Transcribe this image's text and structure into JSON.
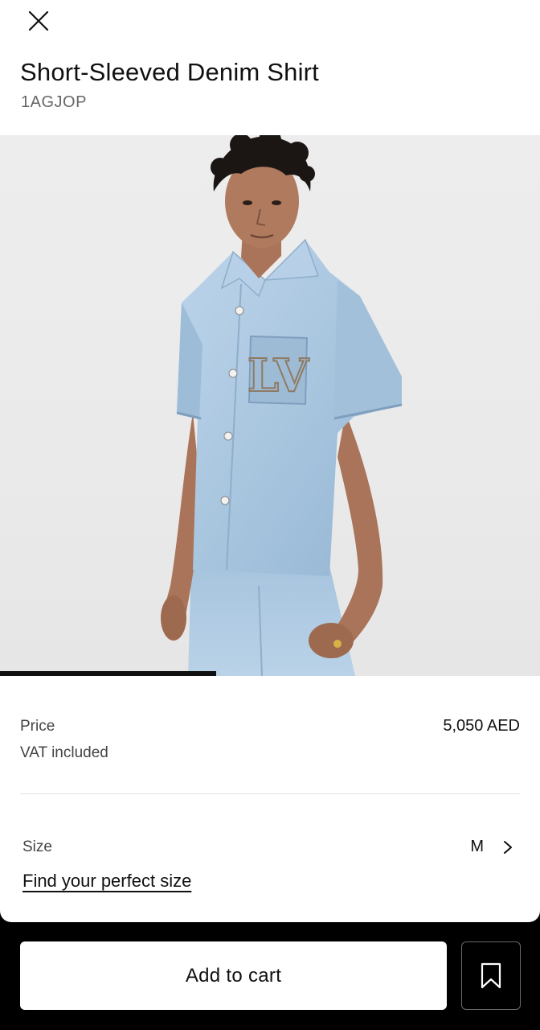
{
  "product": {
    "name": "Short-Sleeved Denim Shirt",
    "sku": "1AGJOP"
  },
  "gallery": {
    "image_description_icon": "product-photo",
    "progress_fraction": 0.4
  },
  "price": {
    "label": "Price",
    "vat_note": "VAT included",
    "value": "5,050 AED"
  },
  "size": {
    "label": "Size",
    "selected": "M",
    "guide_link": "Find your perfect size"
  },
  "actions": {
    "add_to_cart": "Add to cart"
  },
  "icons": {
    "close": "close-icon",
    "chevron": "chevron-right-icon",
    "wishlist": "bookmark-icon"
  },
  "colors": {
    "denim": "#a9c6df",
    "background": "#ffffff",
    "bottom_bar": "#000000"
  }
}
